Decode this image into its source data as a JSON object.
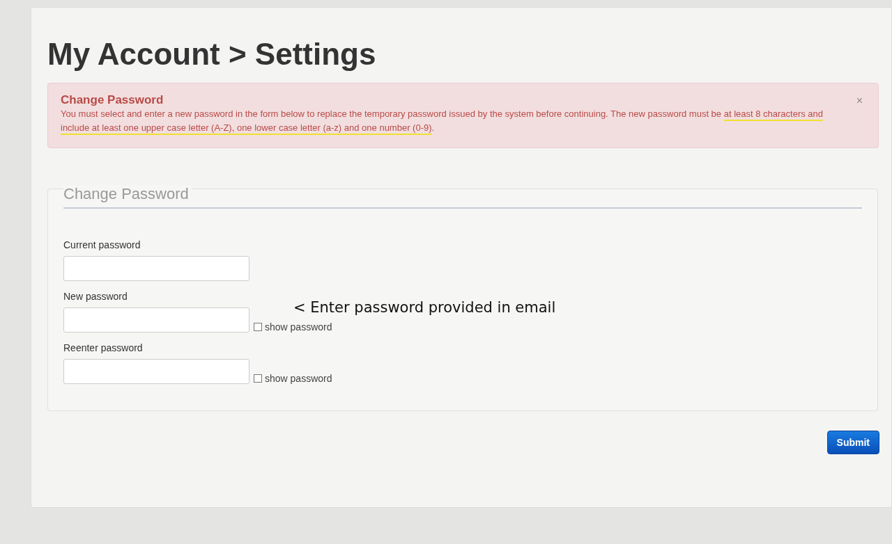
{
  "page_title": "My Account > Settings",
  "alert": {
    "title": "Change Password",
    "close": "×",
    "message": [
      {
        "text": "You must select and enter a new password in the form below to replace the temporary password issued by the system before continuing. The new password must be ",
        "underlined": false
      },
      {
        "text": "at least 8 characters and include at least one upper case letter (A-Z), one lower case letter (a-z) and one number (0-9)",
        "underlined": true
      },
      {
        "text": ".",
        "underlined": false
      }
    ]
  },
  "form": {
    "legend": "Change Password",
    "fields": [
      {
        "label": "Current password"
      },
      {
        "label": "New password",
        "show_password": {
          "label": "show password",
          "checked": false
        }
      },
      {
        "label": "Reenter password",
        "show_password": {
          "label": "show password",
          "checked": false
        }
      }
    ]
  },
  "annotation": "< Enter password provided in email",
  "submit": "Submit"
}
